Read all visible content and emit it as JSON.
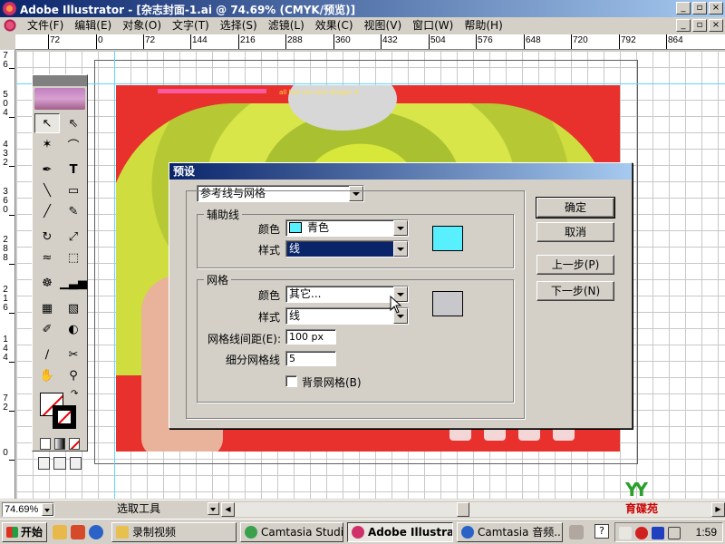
{
  "window": {
    "title": "Adobe Illustrator - [杂志封面-1.ai @ 74.69% (CMYK/预览)]",
    "buttons": [
      "_",
      "▫",
      "×"
    ]
  },
  "menubar": {
    "items": [
      "文件(F)",
      "编辑(E)",
      "对象(O)",
      "文字(T)",
      "选择(S)",
      "滤镜(L)",
      "效果(C)",
      "视图(V)",
      "窗口(W)",
      "帮助(H)"
    ],
    "doc_buttons": [
      "_",
      "▫",
      "×"
    ]
  },
  "ruler": {
    "h_labels": [
      "72",
      "0",
      "72",
      "144",
      "216",
      "288",
      "360",
      "432",
      "504",
      "576",
      "648",
      "720",
      "792",
      "864"
    ],
    "v_labels": [
      "7",
      "6",
      "5",
      "0",
      "4",
      "4",
      "3",
      "2",
      "3",
      "6",
      "0",
      "2",
      "8",
      "8",
      "2",
      "1",
      "6",
      "1",
      "4",
      "4",
      "7",
      "2",
      "0"
    ]
  },
  "artwork": {
    "top_text": "all lost our love dragon 4"
  },
  "dialog": {
    "title": "预设",
    "category_select": "参考线与网格",
    "guides": {
      "group_label": "辅助线",
      "color_label": "颜色",
      "color_value": "青色",
      "color_hex": "#58f0ff",
      "style_label": "样式",
      "style_value": "线"
    },
    "grid": {
      "group_label": "网格",
      "color_label": "颜色",
      "color_value": "其它...",
      "color_hex": "#c8c8cc",
      "style_label": "样式",
      "style_value": "线",
      "spacing_label": "网格线间距(E):",
      "spacing_value": "100 px",
      "subdivisions_label": "细分网格线",
      "subdivisions_value": "5",
      "background_checkbox_label": "背景网格(B)",
      "background_checked": false
    },
    "buttons": {
      "ok": "确定",
      "cancel": "取消",
      "prev": "上一步(P)",
      "next": "下一步(N)"
    }
  },
  "statusbar": {
    "zoom": "74.69%",
    "tool_status": "选取工具"
  },
  "taskbar": {
    "start": "开始",
    "tasks": [
      {
        "label": "录制视频",
        "active": false
      },
      {
        "label": "Camtasia Studio...",
        "active": false
      },
      {
        "label": "Adobe Illustrato...",
        "active": true
      },
      {
        "label": "Camtasia 音频...",
        "active": false
      }
    ],
    "help": "?",
    "clock": "1:59"
  },
  "watermark": {
    "letters": "YY",
    "text": "育碟苑"
  }
}
